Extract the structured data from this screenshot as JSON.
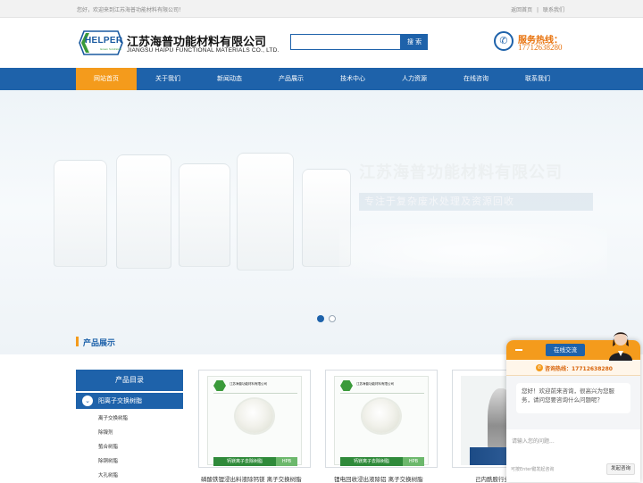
{
  "topbar": {
    "welcome": "您好，欢迎来到江苏海普功能材料有限公司！",
    "home_link": "返回首页",
    "contact_link": "联系我们",
    "divider": "|"
  },
  "header": {
    "logo_text": "HELPER",
    "logo_sub": "Green Solutions",
    "company_cn": "江苏海普功能材料有限公司",
    "company_en": "JIANGSU HAIPU FUNCTIONAL MATERIALS CO., LTD.",
    "search_placeholder": "",
    "search_button": "搜 索",
    "hotline_label": "服务热线：",
    "hotline_number": "17712638280"
  },
  "nav": {
    "items": [
      "网站首页",
      "关于我们",
      "新闻动态",
      "产品展示",
      "技术中心",
      "人力资源",
      "在线咨询",
      "联系我们"
    ],
    "active_index": 0
  },
  "banner": {
    "title": "江苏海普功能材料有限公司",
    "subtitle": "专注于复杂废水处理及资源回收",
    "slides_total": 2,
    "active_slide": 1
  },
  "section": {
    "title": "产品展示"
  },
  "categories": {
    "title": "产品目录",
    "main": "阳离子交换树脂",
    "items": [
      "离子交换树脂",
      "除镍剂",
      "螯合树脂",
      "除铜树脂",
      "大孔树脂"
    ]
  },
  "products": [
    {
      "header": "江苏海普功能材料有限公司",
      "tag": "钙镁离子去除树脂",
      "badge": "HPB",
      "caption": "磷酸铁锂浸出料液除钙镁 离子交换树脂"
    },
    {
      "header": "江苏海普功能材料有限公司",
      "tag": "钙镁离子去除树脂",
      "badge": "HPB",
      "caption": "锂电回收浸出液除铝 离子交换树脂"
    },
    {
      "caption": "己内酰胺行业 ..."
    }
  ],
  "chat": {
    "tab": "在线交流",
    "hotline": "咨询热线：17712638280",
    "greeting": "您好！欢迎前来咨询，很高兴为您服务，请问您要咨询什么问题呢？",
    "input_placeholder": "请输入您的问题...",
    "footer_note": "可按Enter键发起咨询",
    "send_button": "发起咨询"
  },
  "colors": {
    "primary": "#1e62aa",
    "accent": "#f49b1c",
    "hotline": "#e8720c"
  }
}
